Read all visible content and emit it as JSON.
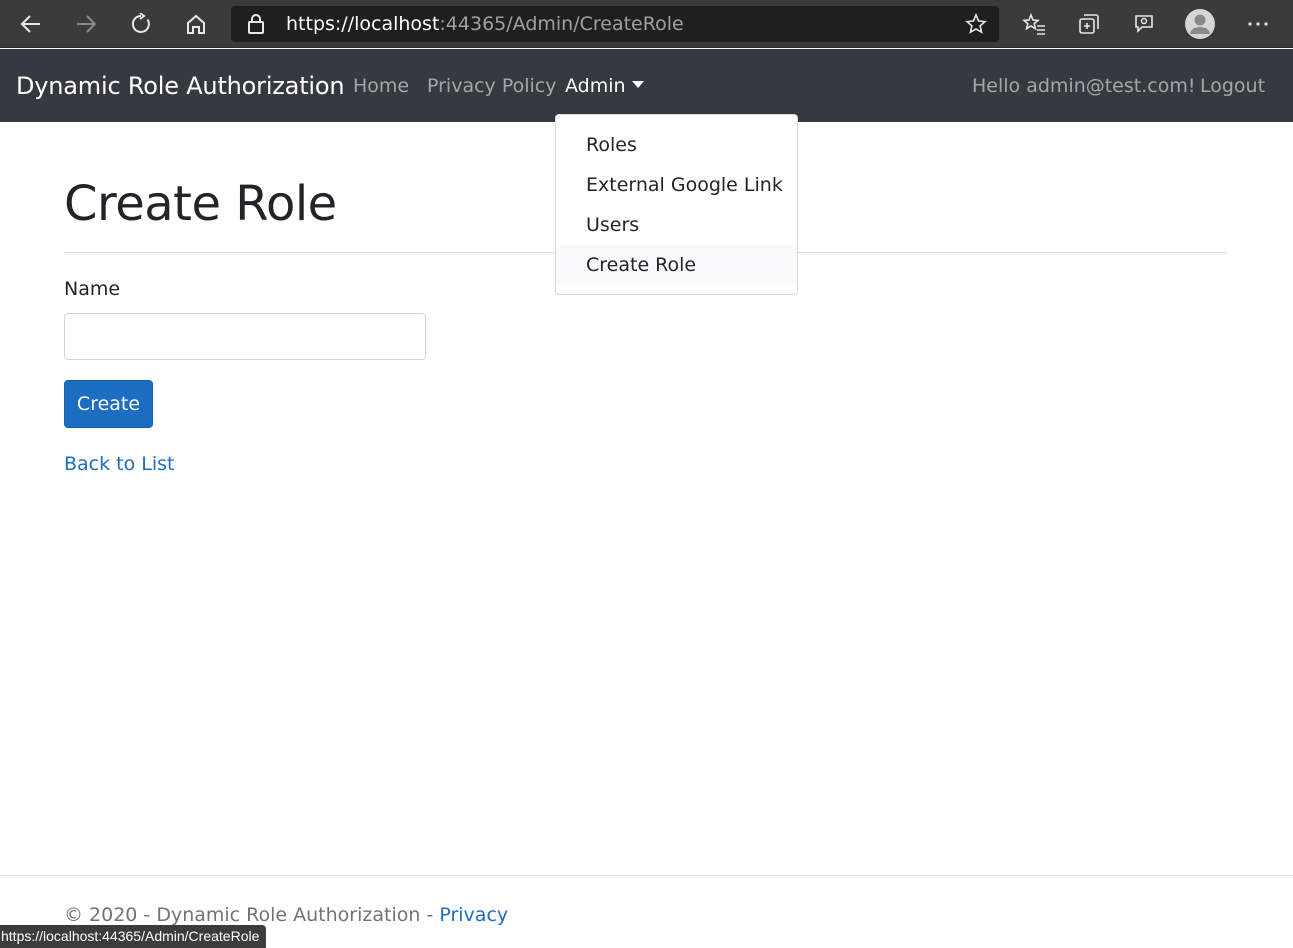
{
  "browser": {
    "url_scheme": "https://",
    "url_host": "localhost",
    "url_rest": ":44365/Admin/CreateRole",
    "icons": [
      "back-arrow-icon",
      "forward-arrow-icon",
      "refresh-icon",
      "home-icon",
      "lock-icon",
      "favorite-star-icon",
      "favorites-list-icon",
      "collections-icon",
      "read-aloud-icon",
      "profile-avatar-icon",
      "more-menu-icon"
    ]
  },
  "navbar": {
    "brand": "Dynamic Role Authorization",
    "links": {
      "home": "Home",
      "privacy": "Privacy Policy",
      "admin": "Admin"
    },
    "greeting": "Hello admin@test.com!",
    "logout": "Logout"
  },
  "admin_dropdown": {
    "items": [
      "Roles",
      "External Google Link",
      "Users",
      "Create Role"
    ],
    "hovered_item": "Create Role"
  },
  "main": {
    "title": "Create Role",
    "name_label": "Name",
    "name_value": "",
    "create_button": "Create",
    "back_link": "Back to List"
  },
  "footer": {
    "text": "© 2020 - Dynamic Role Authorization - ",
    "privacy_link": "Privacy"
  },
  "status_bar": {
    "url": "https://localhost:44365/Admin/CreateRole"
  },
  "colors": {
    "navbar_bg": "#343a40",
    "primary": "#1b6ec2",
    "browser_chrome": "#3b3b3b"
  }
}
